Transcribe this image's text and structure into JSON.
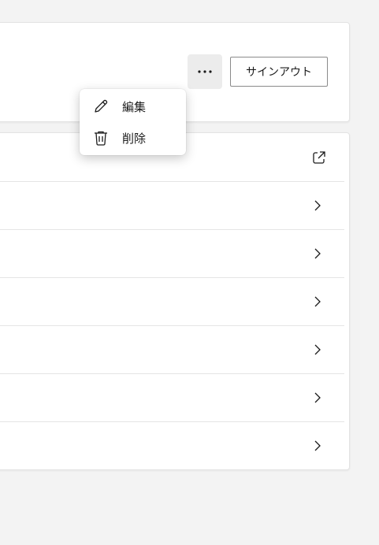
{
  "account": {
    "more_label": "…",
    "signout_label": "サインアウト"
  },
  "context_menu": {
    "items": [
      {
        "label": "編集",
        "icon": "pencil-icon"
      },
      {
        "label": "削除",
        "icon": "trash-icon"
      }
    ]
  },
  "settings_rows": [
    {
      "icon": "external-link-icon"
    },
    {
      "icon": "chevron-right-icon"
    },
    {
      "icon": "chevron-right-icon"
    },
    {
      "icon": "chevron-right-icon"
    },
    {
      "icon": "chevron-right-icon"
    },
    {
      "icon": "chevron-right-icon"
    },
    {
      "icon": "chevron-right-icon"
    }
  ],
  "colors": {
    "background": "#f3f3f3",
    "card": "#ffffff",
    "text": "#1b1b1b",
    "border": "#e5e5e5"
  }
}
